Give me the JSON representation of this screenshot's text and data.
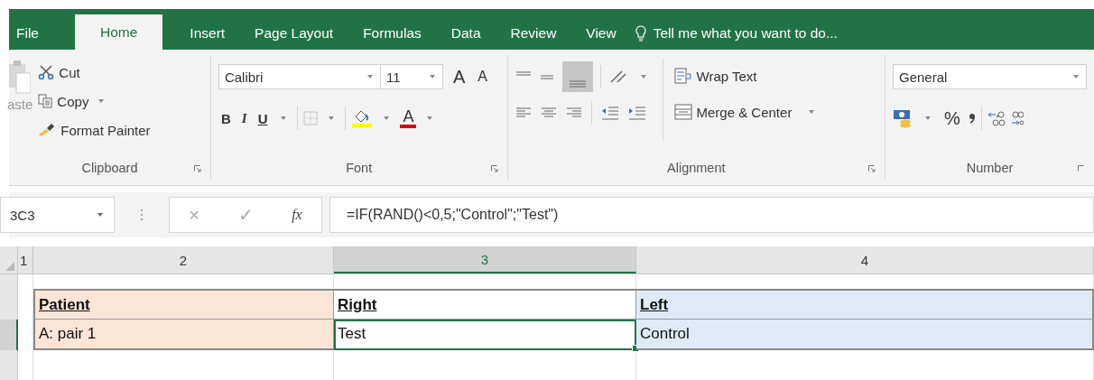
{
  "tabs": [
    {
      "label": "File",
      "selected": false
    },
    {
      "label": "Home",
      "selected": true
    },
    {
      "label": "Insert",
      "selected": false
    },
    {
      "label": "Page Layout",
      "selected": false
    },
    {
      "label": "Formulas",
      "selected": false
    },
    {
      "label": "Data",
      "selected": false
    },
    {
      "label": "Review",
      "selected": false
    },
    {
      "label": "View",
      "selected": false
    }
  ],
  "tell_me": "Tell me what you want to do...",
  "clipboard": {
    "paste": "aste",
    "cut": "Cut",
    "copy": "Copy",
    "format_painter": "Format Painter",
    "label": "Clipboard"
  },
  "font": {
    "name": "Calibri",
    "size": "11",
    "grow": "A",
    "shrink": "A",
    "bold": "B",
    "italic": "I",
    "underline": "U",
    "font_color": "A",
    "label": "Font"
  },
  "alignment": {
    "wrap_text": "Wrap Text",
    "merge": "Merge & Center",
    "label": "Alignment"
  },
  "number": {
    "format": "General",
    "percent": "%",
    "label": "Number"
  },
  "formula_bar": {
    "name_box": "3C3",
    "cancel": "×",
    "enter": "✓",
    "fx": "fx",
    "formula": "=IF(RAND()<0,5;\"Control\";\"Test\")"
  },
  "columns": [
    {
      "label": "1",
      "selected": false
    },
    {
      "label": "2",
      "selected": false
    },
    {
      "label": "3",
      "selected": true
    },
    {
      "label": "4",
      "selected": false
    }
  ],
  "rows": [
    {
      "kind": "header",
      "cells": [
        {
          "text": "Patient",
          "color": "#fbe5d6",
          "selected": false
        },
        {
          "text": "Right",
          "color": "#ffffff",
          "selected": false
        },
        {
          "text": "Left",
          "color": "#deebf7",
          "selected": false
        }
      ]
    },
    {
      "kind": "data",
      "cells": [
        {
          "text": "A: pair 1",
          "color": "#fbe5d6",
          "selected": false
        },
        {
          "text": "Test",
          "color": "#ffffff",
          "selected": true
        },
        {
          "text": "Control",
          "color": "#deebf7",
          "selected": false
        }
      ]
    }
  ]
}
